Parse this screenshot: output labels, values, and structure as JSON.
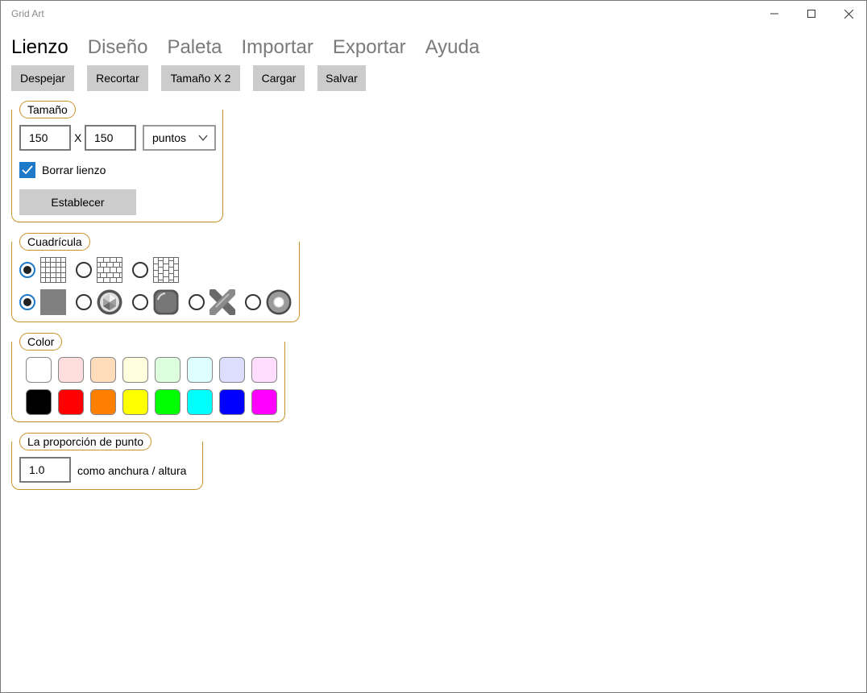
{
  "app": {
    "title": "Grid Art"
  },
  "tabs": [
    {
      "label": "Lienzo",
      "active": true
    },
    {
      "label": "Diseño",
      "active": false
    },
    {
      "label": "Paleta",
      "active": false
    },
    {
      "label": "Importar",
      "active": false
    },
    {
      "label": "Exportar",
      "active": false
    },
    {
      "label": "Ayuda",
      "active": false
    }
  ],
  "toolbar": {
    "clear_label": "Despejar",
    "crop_label": "Recortar",
    "double_label": "Tamaño X 2",
    "load_label": "Cargar",
    "save_label": "Salvar"
  },
  "size_group": {
    "label": "Tamaño",
    "width": "150",
    "times": "X",
    "height": "150",
    "unit": "puntos",
    "clear_canvas_label": "Borrar lienzo",
    "clear_canvas_checked": true,
    "set_label": "Establecer"
  },
  "grid_group": {
    "label": "Cuadrícula",
    "grid_types": [
      {
        "icon": "square-grid-icon",
        "checked": true
      },
      {
        "icon": "brick-horizontal-grid-icon",
        "checked": false
      },
      {
        "icon": "brick-vertical-grid-icon",
        "checked": false
      }
    ],
    "dot_styles": [
      {
        "icon": "flat-square-dot-icon",
        "checked": true
      },
      {
        "icon": "faceted-gem-dot-icon",
        "checked": false
      },
      {
        "icon": "rounded-square-dot-icon",
        "checked": false
      },
      {
        "icon": "cross-stitch-dot-icon",
        "checked": false
      },
      {
        "icon": "ring-bead-dot-icon",
        "checked": false
      }
    ]
  },
  "color_group": {
    "label": "Color",
    "light_colors": [
      "#ffffff",
      "#ffdddd",
      "#ffddbb",
      "#ffffdd",
      "#ddffdd",
      "#ddffff",
      "#ddddff",
      "#ffddff"
    ],
    "strong_colors": [
      "#000000",
      "#ff0000",
      "#ff8000",
      "#ffff00",
      "#00ff00",
      "#00ffff",
      "#0000ff",
      "#ff00ff"
    ]
  },
  "ratio_group": {
    "label": "La proporción de punto",
    "value": "1.0",
    "suffix": "como anchura / altura"
  }
}
